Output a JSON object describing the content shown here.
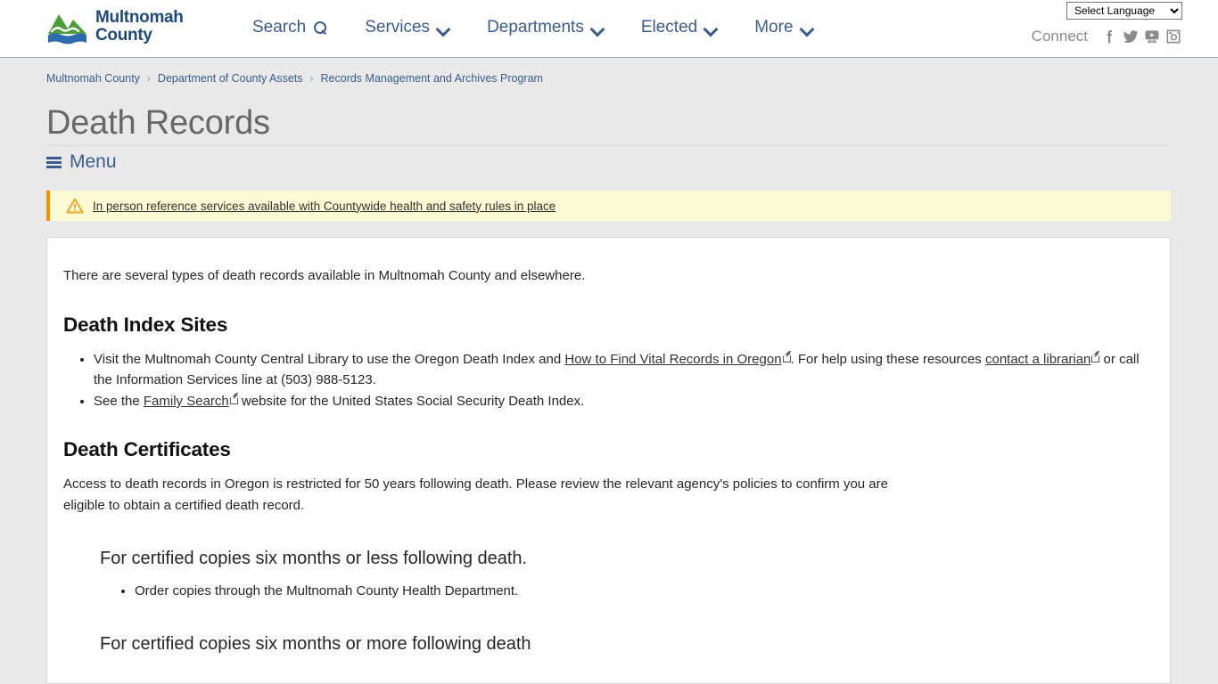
{
  "header": {
    "brand": {
      "line1": "Multnomah",
      "line2": "County",
      "icon": "multnomah-county-logo"
    },
    "nav": [
      {
        "label": "Search",
        "icon": "search-icon"
      },
      {
        "label": "Services",
        "icon": "chevron-down-icon"
      },
      {
        "label": "Departments",
        "icon": "chevron-down-icon"
      },
      {
        "label": "Elected",
        "icon": "chevron-down-icon"
      },
      {
        "label": "More",
        "icon": "chevron-down-icon"
      }
    ],
    "language": {
      "selected": "Select Language"
    },
    "connect": {
      "label": "Connect",
      "icons": [
        "facebook-icon",
        "twitter-icon",
        "youtube-icon",
        "instagram-icon"
      ]
    }
  },
  "breadcrumb": {
    "items": [
      "Multnomah County",
      "Department of County Assets",
      "Records Management and Archives Program"
    ],
    "separator": "›"
  },
  "page": {
    "title": "Death Records",
    "menu_label": "Menu",
    "menu_icon": "hamburger-icon"
  },
  "alert": {
    "icon": "warning-triangle-icon",
    "text": "In person reference services available with Countywide health and safety rules in place",
    "accent_color": "#f29400",
    "background_color": "#fdfbd5"
  },
  "main": {
    "intro": "There are several types of death records available in Multnomah County and elsewhere.",
    "section1": {
      "heading": "Death Index Sites",
      "item1_pre": "Visit the Multnomah County Central Library to use the Oregon Death Index and ",
      "item1_link1": "How to Find Vital Records in Oregon",
      "item1_mid": ". For help using these resources ",
      "item1_link2": "contact a librarian",
      "item1_post": " or call the Information Services line at (503) 988-5123.",
      "item2_pre": "See the ",
      "item2_link": "Family Search",
      "item2_post": " website for the United States Social Security Death Index."
    },
    "section2": {
      "heading": "Death Certificates",
      "paragraph": "Access to death records in Oregon is restricted for 50 years following death. Please review the relevant agency's policies to confirm you are eligible to obtain a certified death record.",
      "sub1_heading": "For certified copies six months or less following death.",
      "sub1_bullet": "Order copies through the Multnomah County Health Department.",
      "sub2_heading": "For certified copies six months or more following death"
    }
  },
  "colors": {
    "brand_blue": "#1e4b7b",
    "nav_blue": "#3b5c8f",
    "page_background": "#e9e9e9",
    "logo_green": "#4f9c3a",
    "logo_blue": "#2b6cb0"
  }
}
